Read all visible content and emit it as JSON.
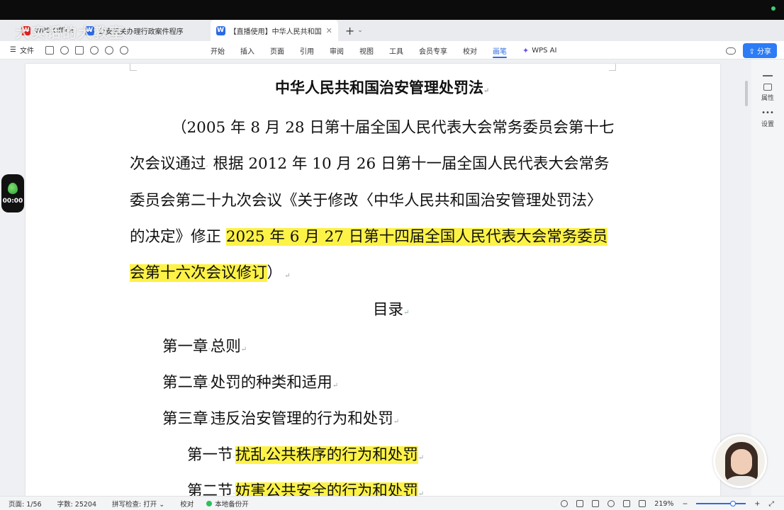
{
  "tabs": [
    {
      "icon": "W",
      "label": "WPS Office"
    },
    {
      "icon": "W",
      "label": "公安机关办理行政案件程序规定"
    },
    {
      "icon": "W",
      "label": "【直播使用】中华人民共和国治安管理处罚法"
    }
  ],
  "watermark": "大实话的大教室",
  "ribbon": {
    "file_menu": "文件",
    "tabs": [
      "开始",
      "插入",
      "页面",
      "引用",
      "审阅",
      "视图",
      "工具",
      "会员专享",
      "校对",
      "画笔"
    ],
    "active_tab": "画笔",
    "ai_label": "WPS AI",
    "share_label": "分享"
  },
  "side_panel": {
    "properties": "属性",
    "settings": "设置"
  },
  "recorder_time": "00:00",
  "document": {
    "title": "中华人民共和国治安管理处罚法",
    "para_lines": [
      "（2005 年 8 月 28 日第十届全国人民代表大会常务委员会第十七",
      "次会议通过",
      "根据 2012 年 10 月 26 日第十一届全国人民代表大会常务",
      "委员会第二十九次会议《关于修改〈中华人民共和国治安管理处罚法〉",
      "的决定》修正 ",
      "2025 年 6 月 27 日第十四届全国人民代表大会常务委员",
      "会第十六次会议修订",
      "）"
    ],
    "toc_title": "目录",
    "toc": [
      {
        "label": "第一章",
        "text": "总则"
      },
      {
        "label": "第二章",
        "text": "处罚的种类和适用"
      },
      {
        "label": "第三章",
        "text": "违反治安管理的行为和处罚"
      },
      {
        "label": "第一节",
        "text": "扰乱公共秩序的行为和处罚"
      },
      {
        "label": "第二节",
        "text": "妨害公共安全的行为和处罚"
      }
    ]
  },
  "status": {
    "page": "页面: 1/56",
    "words": "字数: 25204",
    "spell": "拼写检查: 打开",
    "proof": "校对",
    "backup": "本地备份开",
    "zoom": "219%"
  }
}
